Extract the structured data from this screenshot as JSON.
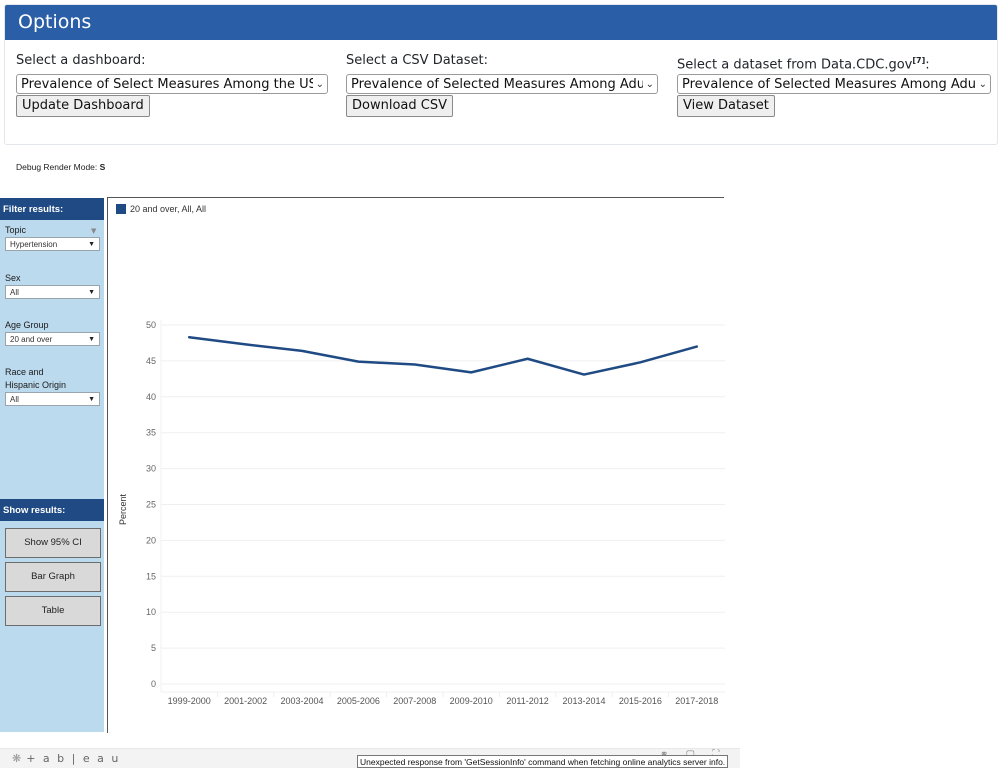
{
  "options": {
    "title": "Options",
    "dashboard": {
      "label": "Select a dashboard:",
      "selected": "Prevalence of Select Measures Among the US Pop",
      "button": "Update Dashboard"
    },
    "csv": {
      "label": "Select a CSV Dataset:",
      "selected": "Prevalence of Selected Measures Among Adults A",
      "button": "Download CSV"
    },
    "cdc": {
      "label": "Select a dataset from Data.CDC.gov",
      "label_sup": "[7]",
      "label_suffix": ":",
      "selected": "Prevalence of Selected Measures Among Adults A",
      "button": "View Dataset"
    }
  },
  "debug": {
    "label": "Debug Render Mode:",
    "value": "S"
  },
  "sidebar": {
    "filter_header": "Filter results:",
    "filters": [
      {
        "label": "Topic",
        "value": "Hypertension"
      },
      {
        "label": "Sex",
        "value": "All"
      },
      {
        "label": "Age Group",
        "value": "20 and over"
      },
      {
        "label": "Race and Hispanic Origin",
        "label_line1": "Race and",
        "label_line2": "Hispanic Origin",
        "value": "All"
      }
    ],
    "show_header": "Show results:",
    "buttons": [
      "Show 95% CI",
      "Bar Graph",
      "Table"
    ]
  },
  "chart_data": {
    "type": "line",
    "title": "",
    "xlabel": "",
    "ylabel": "Percent",
    "ylim": [
      0,
      50
    ],
    "yticks": [
      0,
      5,
      10,
      15,
      20,
      25,
      30,
      35,
      40,
      45,
      50
    ],
    "grid": true,
    "legend_position": "top-left",
    "categories": [
      "1999-2000",
      "2001-2002",
      "2003-2004",
      "2005-2006",
      "2007-2008",
      "2009-2010",
      "2011-2012",
      "2013-2014",
      "2015-2016",
      "2017-2018"
    ],
    "series": [
      {
        "name": "20 and over, All, All",
        "color": "#1f4a83",
        "values": [
          48.3,
          47.3,
          46.4,
          44.9,
          44.5,
          43.4,
          45.3,
          43.1,
          44.8,
          47.0
        ]
      }
    ]
  },
  "footer": {
    "logo": "+ a b | e a u",
    "error": "Unexpected response from 'GetSessionInfo' command when fetching online analytics server info."
  },
  "colors": {
    "header_blue": "#2a5ea6",
    "sidebar_bg": "#bcdaee",
    "sidebar_header": "#1f4a83",
    "line": "#1f4a83"
  }
}
